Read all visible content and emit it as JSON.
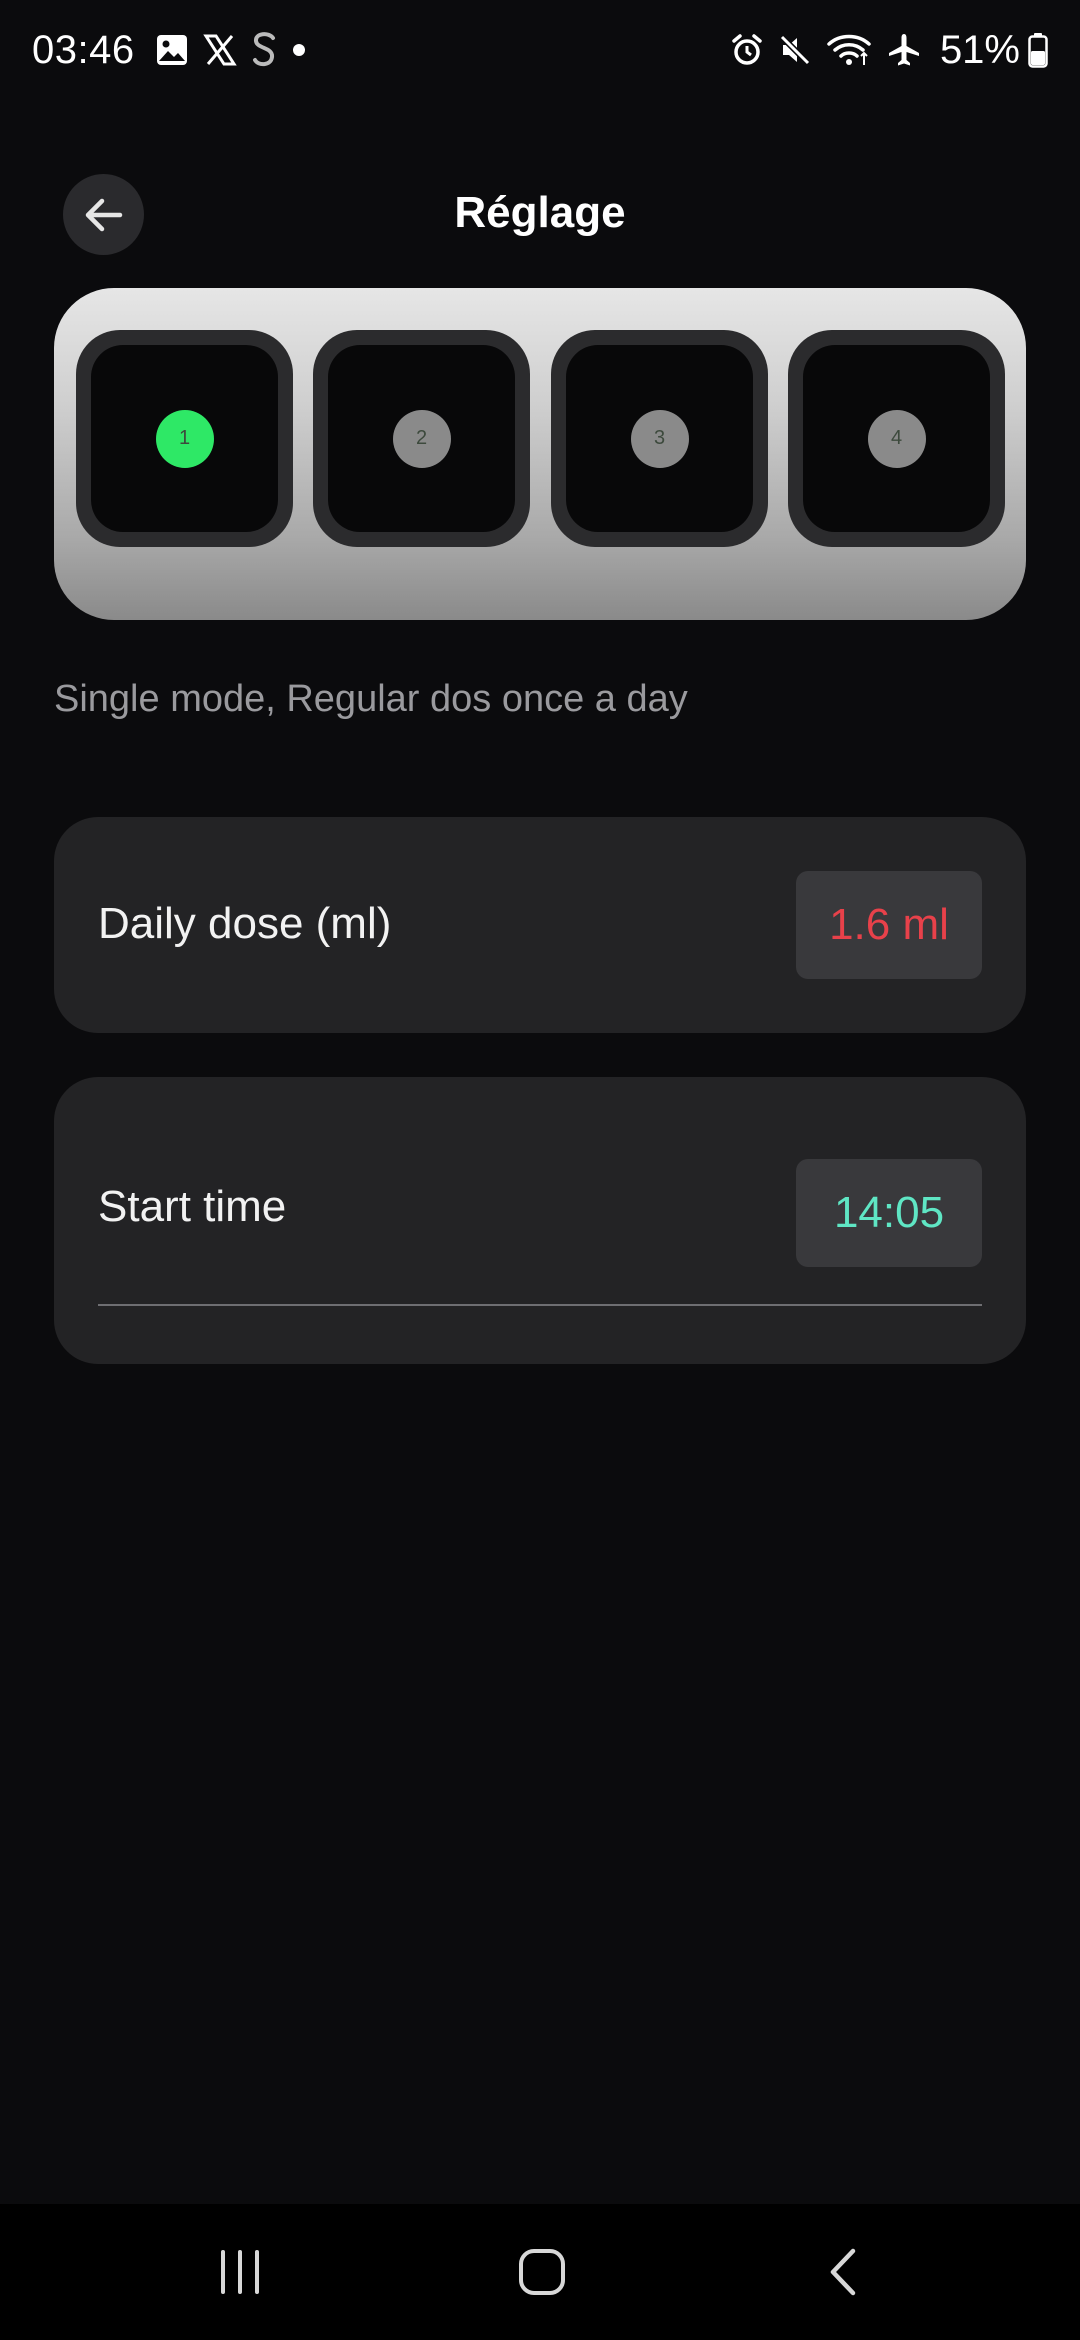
{
  "status_bar": {
    "time": "03:46",
    "battery": "51%",
    "left_icons": [
      "gallery-icon",
      "x-logo-icon",
      "s-app-icon",
      "dot-icon"
    ],
    "right_icons": [
      "alarm-icon",
      "mute-icon",
      "wifi-icon",
      "airplane-icon",
      "battery-icon"
    ]
  },
  "header": {
    "title": "Réglage"
  },
  "device": {
    "slots": [
      {
        "label": "1",
        "active": true
      },
      {
        "label": "2",
        "active": false
      },
      {
        "label": "3",
        "active": false
      },
      {
        "label": "4",
        "active": false
      }
    ]
  },
  "mode_text": "Single mode, Regular dos once a day",
  "dose_card": {
    "label": "Daily dose (ml)",
    "value": "1.6 ml"
  },
  "time_card": {
    "label": "Start time",
    "value": "14:05"
  },
  "colors": {
    "active_slot": "#2ee866",
    "inactive_slot": "#8a8a8a",
    "dose_value": "#e8414a",
    "time_value": "#5fe6c4"
  },
  "nav": {
    "items": [
      "recents-icon",
      "home-icon",
      "back-icon"
    ]
  }
}
